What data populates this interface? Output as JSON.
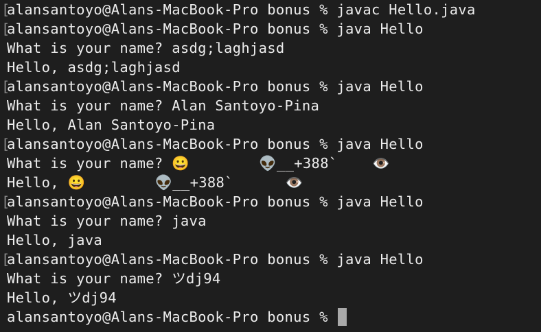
{
  "terminal": {
    "lines": [
      {
        "mark": "[",
        "text": "alansantoyo@Alans-MacBook-Pro bonus % javac Hello.java"
      },
      {
        "mark": "[",
        "text": "alansantoyo@Alans-MacBook-Pro bonus % java Hello"
      },
      {
        "mark": "",
        "text": "What is your name? asdg;laghjasd"
      },
      {
        "mark": "",
        "text": "Hello, asdg;laghjasd"
      },
      {
        "mark": "[",
        "text": "alansantoyo@Alans-MacBook-Pro bonus % java Hello"
      },
      {
        "mark": "",
        "text": "What is your name? Alan Santoyo-Pina"
      },
      {
        "mark": "",
        "text": "Hello, Alan Santoyo-Pina"
      },
      {
        "mark": "[",
        "text": "alansantoyo@Alans-MacBook-Pro bonus % java Hello"
      },
      {
        "mark": "",
        "text": "What is your name? 😀        👽__+388`    👁️"
      },
      {
        "mark": "",
        "text": "Hello, 😀        👽__+388`      👁️"
      },
      {
        "mark": "[",
        "text": "alansantoyo@Alans-MacBook-Pro bonus % java Hello"
      },
      {
        "mark": "",
        "text": "What is your name? java"
      },
      {
        "mark": "",
        "text": "Hello, java"
      },
      {
        "mark": "[",
        "text": "alansantoyo@Alans-MacBook-Pro bonus % java Hello"
      },
      {
        "mark": "",
        "text": "What is your name? ツdj94"
      },
      {
        "mark": "",
        "text": "Hello, ツdj94"
      },
      {
        "mark": "",
        "text": "alansantoyo@Alans-MacBook-Pro bonus % "
      }
    ]
  }
}
